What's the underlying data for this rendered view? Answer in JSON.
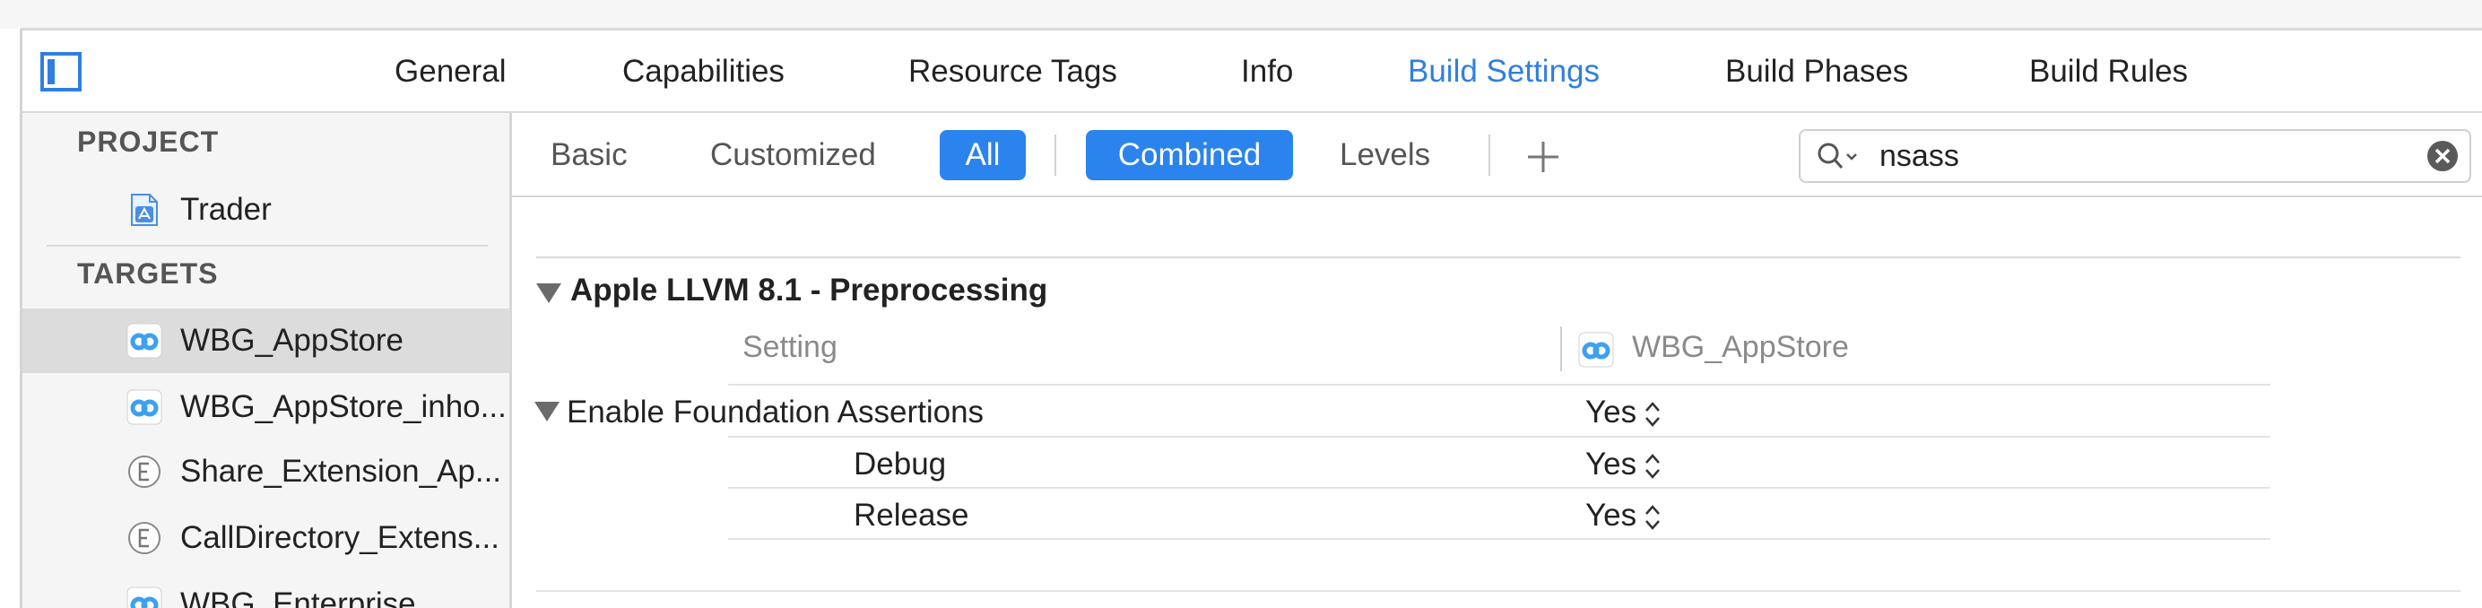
{
  "tabs": [
    {
      "label": "General"
    },
    {
      "label": "Capabilities"
    },
    {
      "label": "Resource Tags"
    },
    {
      "label": "Info"
    },
    {
      "label": "Build Settings"
    },
    {
      "label": "Build Phases"
    },
    {
      "label": "Build Rules"
    }
  ],
  "active_tab": "Build Settings",
  "accent_color": "#2f7fe0",
  "sidebar": {
    "project_header": "PROJECT",
    "project_items": [
      {
        "label": "Trader",
        "icon": "app-project-icon"
      }
    ],
    "targets_header": "TARGETS",
    "target_items": [
      {
        "label": "WBG_AppStore",
        "icon": "app-target-icon",
        "selected": true
      },
      {
        "label": "WBG_AppStore_inho...",
        "icon": "app-target-icon"
      },
      {
        "label": "Share_Extension_Ap...",
        "icon": "extension-icon"
      },
      {
        "label": "CallDirectory_Extens...",
        "icon": "extension-icon"
      },
      {
        "label": "WBG_Enterprise",
        "icon": "app-target-icon"
      }
    ]
  },
  "filter_bar": {
    "basic": "Basic",
    "customized": "Customized",
    "all": "All",
    "combined": "Combined",
    "levels": "Levels",
    "add_icon": "plus-icon"
  },
  "search": {
    "value": "nsass",
    "icon": "search-icon"
  },
  "content": {
    "section_title": "Apple LLVM 8.1 - Preprocessing",
    "columns": {
      "setting": "Setting",
      "target": "WBG_AppStore"
    },
    "setting": {
      "name": "Enable Foundation Assertions",
      "value": "Yes",
      "levels": [
        {
          "name": "Debug",
          "value": "Yes"
        },
        {
          "name": "Release",
          "value": "Yes"
        }
      ]
    }
  }
}
